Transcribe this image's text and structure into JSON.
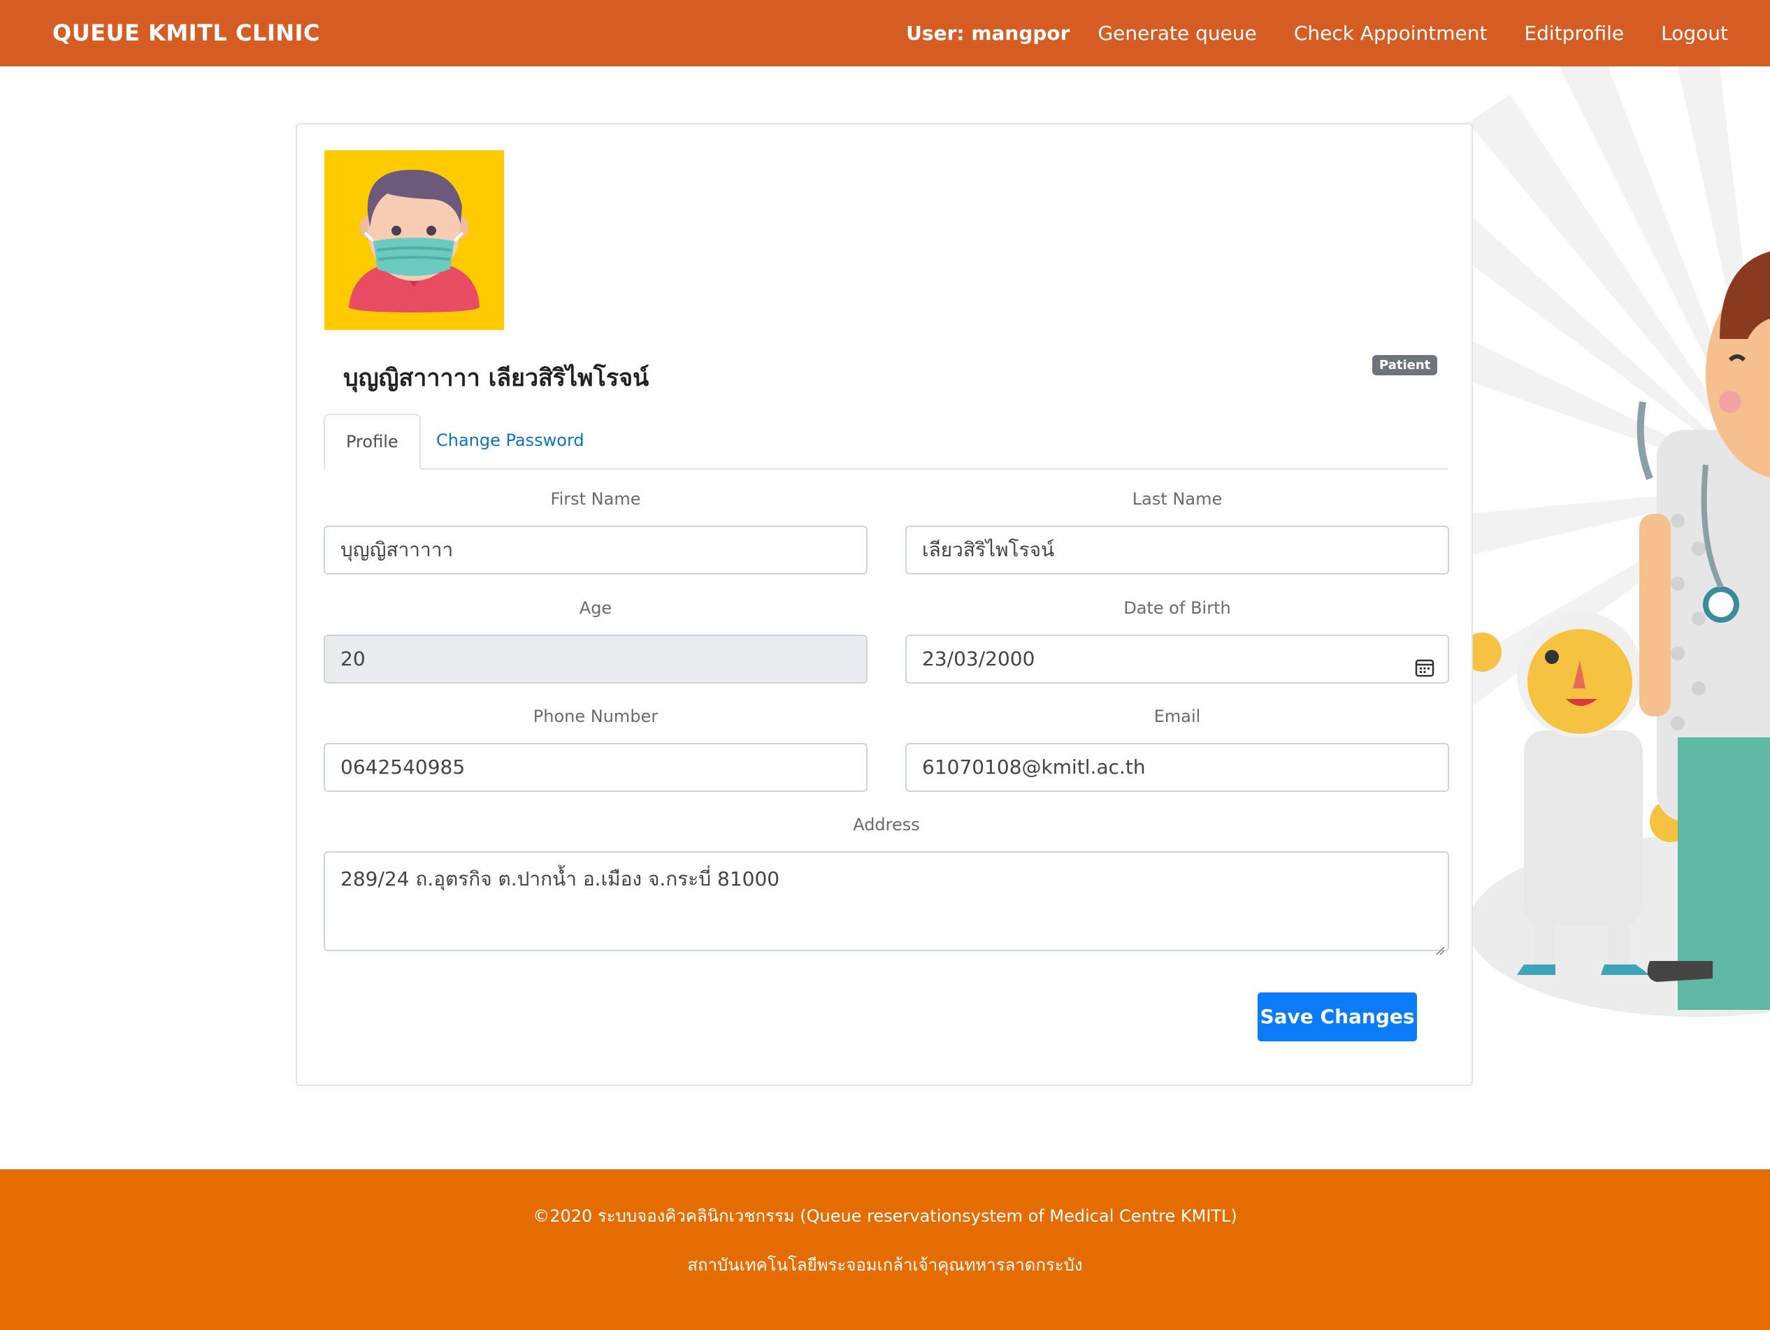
{
  "navbar": {
    "brand": "QUEUE KMITL CLINIC",
    "user": "User: mangpor",
    "links": [
      "Generate queue",
      "Check Appointment",
      "Editprofile",
      "Logout"
    ]
  },
  "profile": {
    "name": "บุญญิสาาาาา เลียวสิริไพโรจน์",
    "role_badge": "Patient",
    "avatar": "masked-man-avatar"
  },
  "tabs": {
    "profile": "Profile",
    "change_password": "Change Password"
  },
  "form": {
    "first_name_label": "First Name",
    "first_name": "บุญญิสาาาาา",
    "last_name_label": "Last Name",
    "last_name": "เลียวสิริไพโรจน์",
    "age_label": "Age",
    "age": "20",
    "dob_label": "Date of Birth",
    "dob": "23/03/2000",
    "phone_label": "Phone Number",
    "phone": "0642540985",
    "email_label": "Email",
    "email": "61070108@kmitl.ac.th",
    "address_label": "Address",
    "address": "289/24 ถ.อุตรกิจ ต.ปากน้ำ อ.เมือง จ.กระบี่ 81000",
    "save_label": "Save Changes"
  },
  "footer": {
    "line1": "©2020 ระบบจองคิวคลินิกเวชกรรม (Queue reservationsystem of Medical Centre KMITL)",
    "line2": "สถาบันเทคโนโลยีพระจอมเกล้าเจ้าคุณทหารลาดกระบัง"
  },
  "colors": {
    "navbar": "#d55d24",
    "footer": "#e46c00",
    "primary": "#0b7bf7",
    "avatar_bg": "#fdcb00"
  }
}
